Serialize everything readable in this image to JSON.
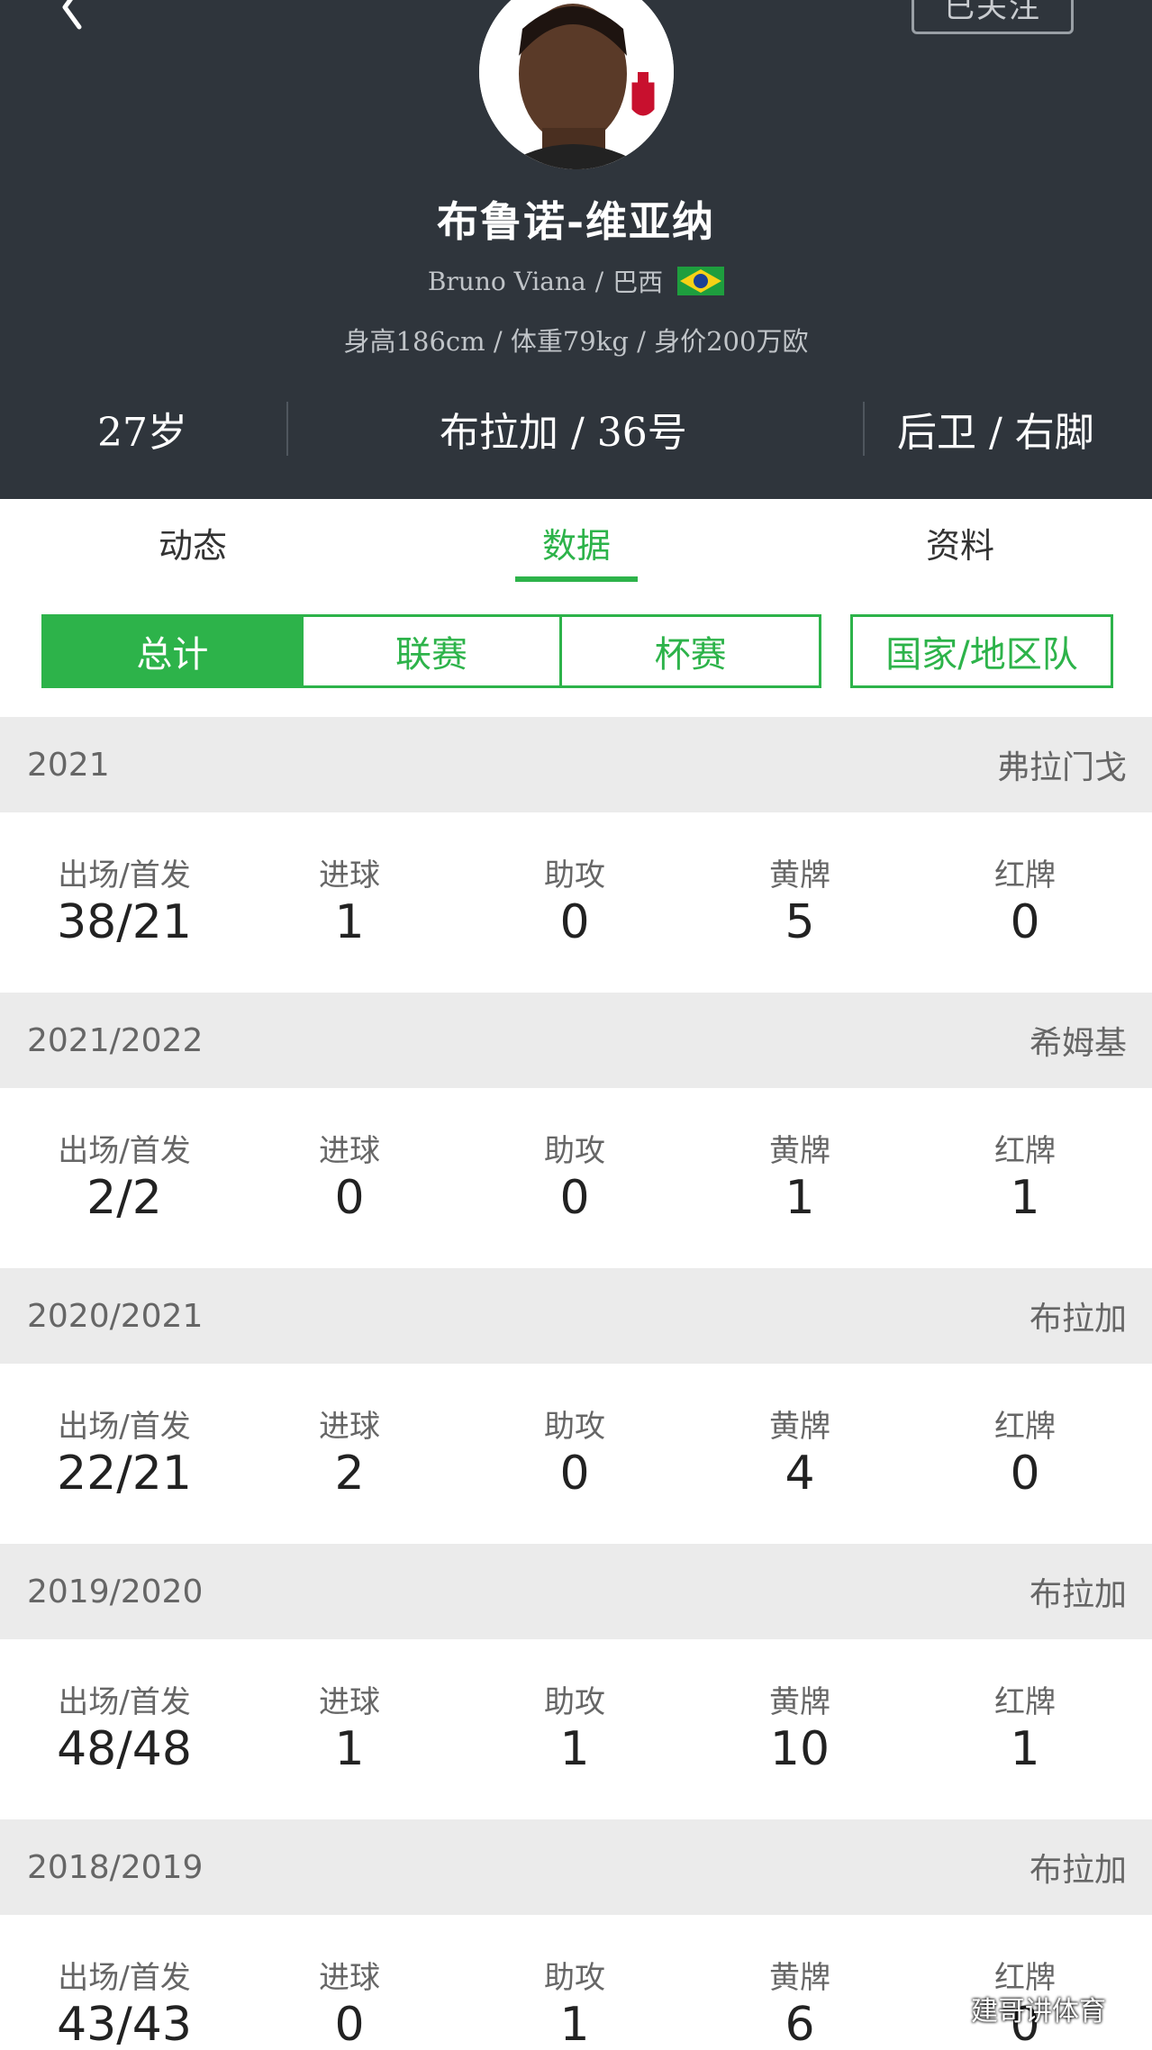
{
  "header": {
    "follow_label": "已关注",
    "name": "布鲁诺-维亚纳",
    "english_name": "Bruno Viana",
    "separator": "/",
    "nationality": "巴西",
    "body_info": "身高186cm / 体重79kg / 身价200万欧",
    "age": "27岁",
    "club_number": "布拉加 / 36号",
    "position_foot": "后卫 / 右脚"
  },
  "tabs": [
    "动态",
    "数据",
    "资料"
  ],
  "active_tab": 1,
  "filters": {
    "segments": [
      "总计",
      "联赛",
      "杯赛"
    ],
    "active_segment": 0,
    "national_team": "国家/地区队"
  },
  "stat_labels": [
    "出场/首发",
    "进球",
    "助攻",
    "黄牌",
    "红牌"
  ],
  "seasons": [
    {
      "season": "2021",
      "club": "弗拉门戈",
      "values": [
        "38/21",
        "1",
        "0",
        "5",
        "0"
      ]
    },
    {
      "season": "2021/2022",
      "club": "希姆基",
      "values": [
        "2/2",
        "0",
        "0",
        "1",
        "1"
      ]
    },
    {
      "season": "2020/2021",
      "club": "布拉加",
      "values": [
        "22/21",
        "2",
        "0",
        "4",
        "0"
      ]
    },
    {
      "season": "2019/2020",
      "club": "布拉加",
      "values": [
        "48/48",
        "1",
        "1",
        "10",
        "1"
      ]
    },
    {
      "season": "2018/2019",
      "club": "布拉加",
      "values": [
        "43/43",
        "0",
        "1",
        "6",
        "0"
      ]
    }
  ],
  "watermark": "建哥讲体育",
  "colors": {
    "accent": "#2db34a",
    "header_bg": "#2f353c",
    "section_bg": "#ebebeb"
  }
}
